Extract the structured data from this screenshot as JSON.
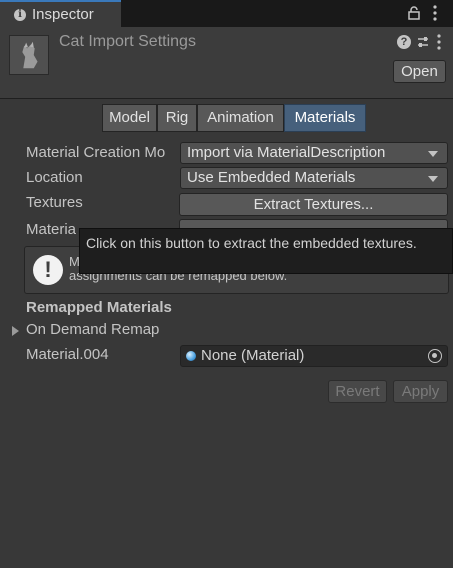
{
  "window": {
    "tab_label": "Inspector",
    "tab_icon": "info-icon",
    "lock_icon": "lock-icon",
    "menu_icon": "kebab-menu-icon"
  },
  "header": {
    "title": "Cat Import Settings",
    "help_glyph": "?",
    "open_label": "Open"
  },
  "tabs": [
    {
      "label": "Model",
      "selected": false
    },
    {
      "label": "Rig",
      "selected": false
    },
    {
      "label": "Animation",
      "selected": false
    },
    {
      "label": "Materials",
      "selected": true
    }
  ],
  "fields": {
    "material_creation": {
      "label": "Material Creation Mo",
      "value": "Import via MaterialDescription"
    },
    "location": {
      "label": "Location",
      "value": "Use Embedded Materials"
    },
    "textures": {
      "label": "Textures",
      "button": "Extract Textures..."
    },
    "materials": {
      "label": "Materia"
    }
  },
  "help_box": {
    "glyph": "!",
    "line1": "M",
    "line2": "assignments can be remapped below."
  },
  "remapped": {
    "section_title": "Remapped Materials",
    "foldout_label": "On Demand Remap",
    "material_name": "Material.004",
    "material_value": "None (Material)"
  },
  "actions": {
    "revert": "Revert",
    "apply": "Apply"
  },
  "tooltip": {
    "text": "Click on this button to extract the embedded textures."
  },
  "colors": {
    "selected_tab": "#46607c",
    "accent": "#3a79bb"
  }
}
